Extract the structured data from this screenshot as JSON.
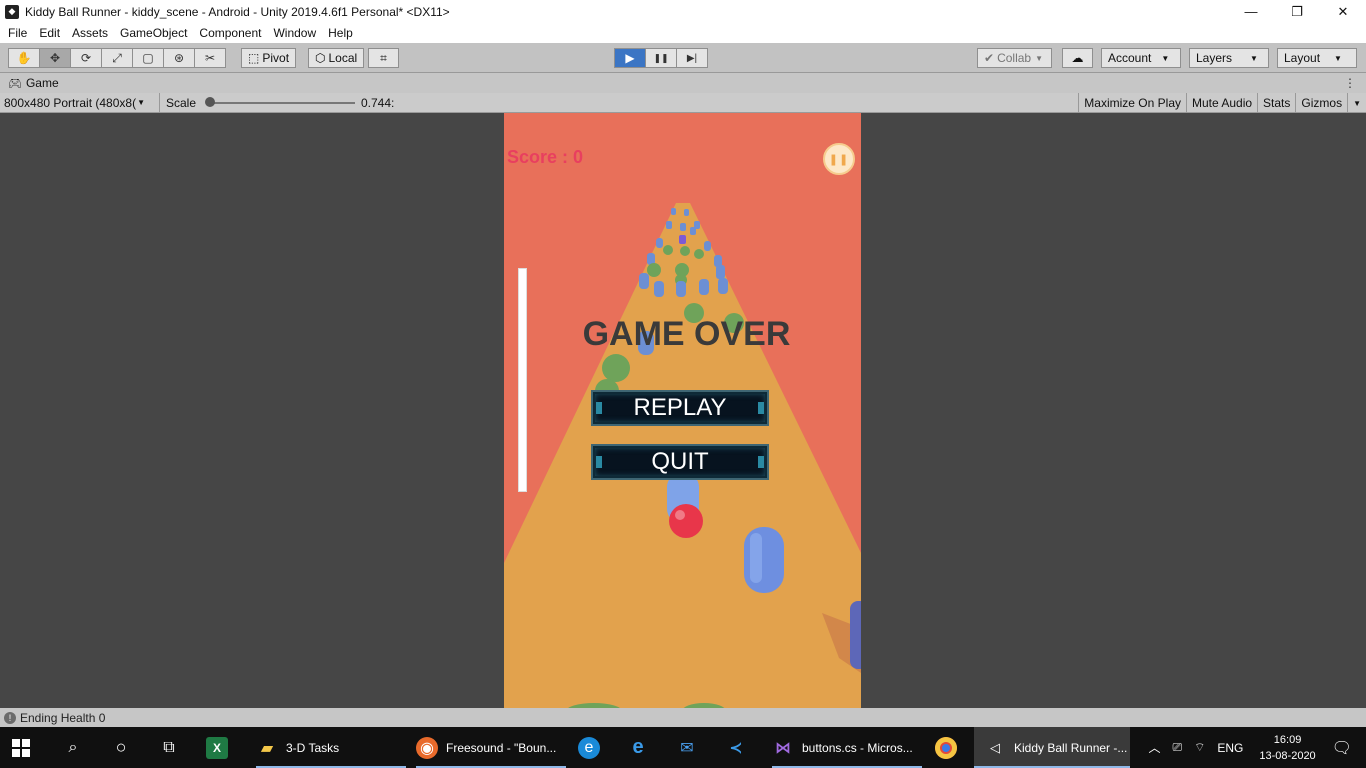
{
  "window": {
    "title": "Kiddy Ball Runner - kiddy_scene - Android - Unity 2019.4.6f1 Personal* <DX11>",
    "minimize": "—",
    "restore": "❐",
    "close": "✕"
  },
  "menu": [
    "File",
    "Edit",
    "Assets",
    "GameObject",
    "Component",
    "Window",
    "Help"
  ],
  "toolbar": {
    "pivot_label": "Pivot",
    "local_label": "Local",
    "collab_label": "Collab",
    "account_label": "Account",
    "layers_label": "Layers",
    "layout_label": "Layout",
    "play_icon": "▶",
    "pause_icon": "❚❚",
    "step_icon": "▶|"
  },
  "game_tab": {
    "label": "Game"
  },
  "game_view": {
    "resolution": "800x480 Portrait (480x8(",
    "scale_label": "Scale",
    "scale_value": "0.744:",
    "maximize_on_play": "Maximize On Play",
    "mute_audio": "Mute Audio",
    "stats": "Stats",
    "gizmos": "Gizmos"
  },
  "game": {
    "score_text": "Score : 0",
    "game_over_text": "GAME OVER",
    "replay_label": "REPLAY",
    "quit_label": "QUIT",
    "pause_icon": "❚❚"
  },
  "status": {
    "message": "Ending Health 0"
  },
  "taskbar": {
    "items": [
      {
        "label": "3-D Tasks"
      },
      {
        "label": "Freesound - \"Boun..."
      },
      {
        "label": "buttons.cs - Micros..."
      },
      {
        "label": "Kiddy Ball Runner -..."
      }
    ],
    "language": "ENG",
    "time": "16:09",
    "date": "13-08-2020"
  }
}
